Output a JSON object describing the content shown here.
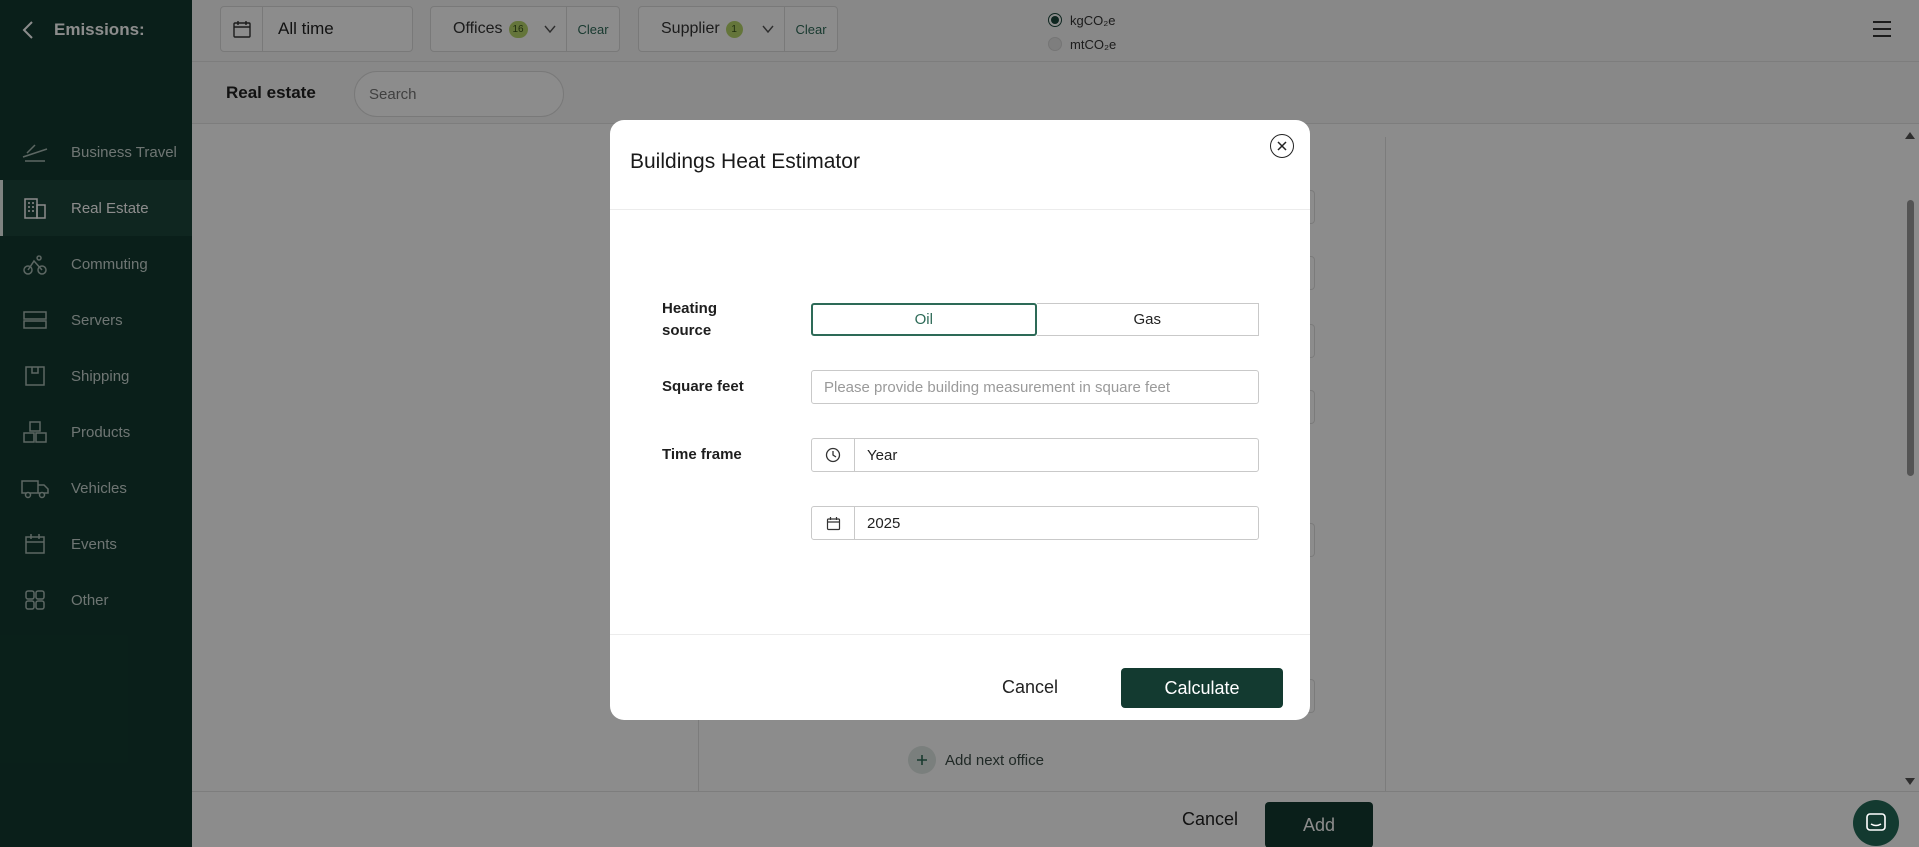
{
  "sidebar": {
    "title": "Emissions:",
    "items": [
      {
        "label": "Business Travel",
        "icon": "plane-icon"
      },
      {
        "label": "Real Estate",
        "icon": "building-icon",
        "active": true
      },
      {
        "label": "Commuting",
        "icon": "commute-icon"
      },
      {
        "label": "Servers",
        "icon": "server-icon"
      },
      {
        "label": "Shipping",
        "icon": "box-icon"
      },
      {
        "label": "Products",
        "icon": "products-icon"
      },
      {
        "label": "Vehicles",
        "icon": "truck-icon"
      },
      {
        "label": "Events",
        "icon": "calendar-icon"
      },
      {
        "label": "Other",
        "icon": "grid-icon"
      }
    ]
  },
  "topbar": {
    "date_range": "All time",
    "offices": {
      "label": "Offices",
      "count": "16",
      "clear": "Clear"
    },
    "supplier": {
      "label": "Supplier",
      "count": "1",
      "clear": "Clear"
    },
    "units": [
      {
        "label": "kgCO₂e",
        "selected": true
      },
      {
        "label": "mtCO₂e",
        "selected": false
      }
    ]
  },
  "subbar": {
    "title": "Real estate",
    "search_placeholder": "Search"
  },
  "content": {
    "add_next_office": "Add next office"
  },
  "footer": {
    "cancel": "Cancel",
    "add": "Add"
  },
  "modal": {
    "title": "Buildings Heat Estimator",
    "heating_source_label": "Heating source",
    "heating_options": [
      {
        "label": "Oil",
        "selected": true
      },
      {
        "label": "Gas",
        "selected": false
      }
    ],
    "square_feet_label": "Square feet",
    "square_feet_placeholder": "Please provide building measurement in square feet",
    "square_feet_value": "",
    "time_frame_label": "Time frame",
    "time_frame_value": "Year",
    "year_value": "2025",
    "cancel": "Cancel",
    "calculate": "Calculate"
  },
  "colors": {
    "sidebar_bg": "#133a30",
    "accent": "#2d6a57",
    "badge": "#b7d66b"
  }
}
